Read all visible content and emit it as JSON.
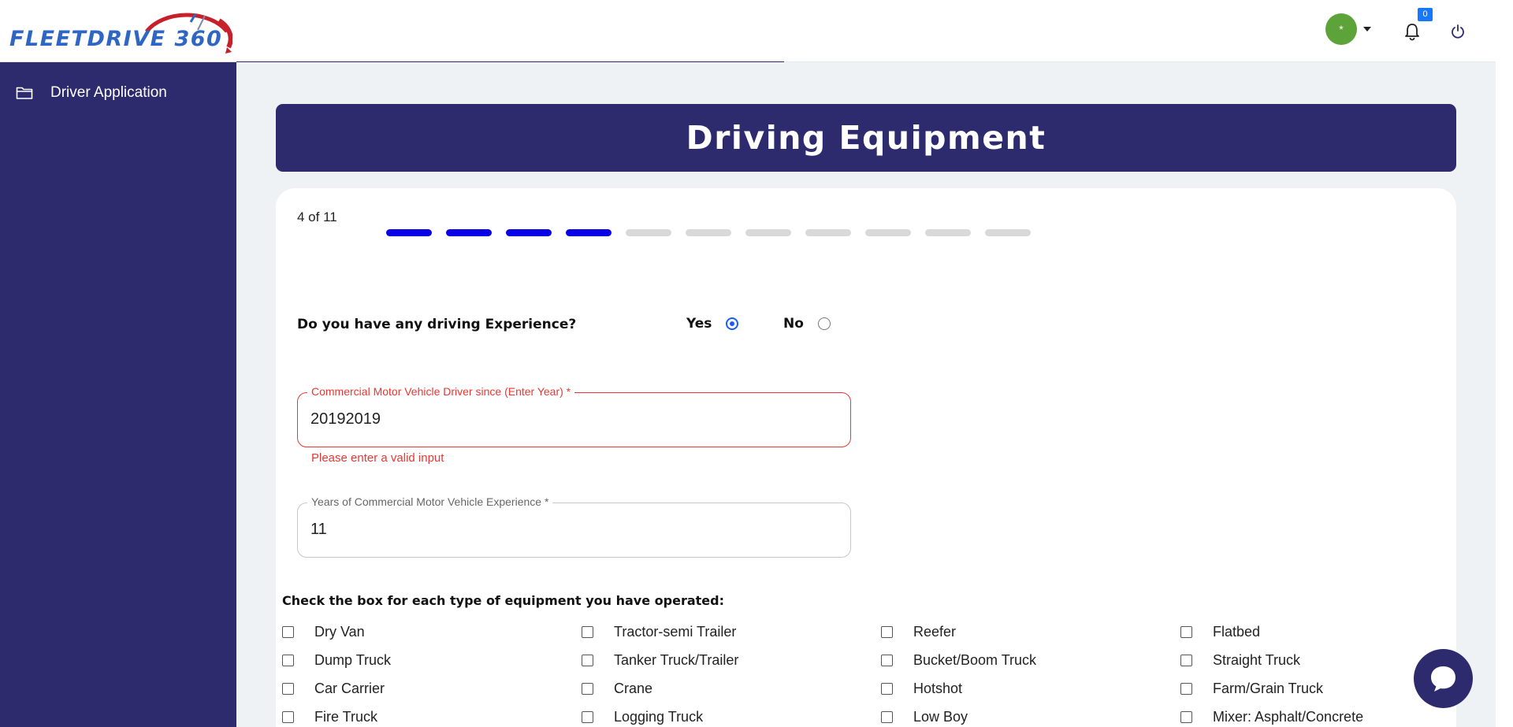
{
  "header": {
    "logo_text": "FLEETDRIVE 360",
    "avatar_initial": "*",
    "notification_count": "0"
  },
  "sidebar": {
    "items": [
      {
        "label": "Driver Application",
        "icon": "folder-icon"
      }
    ]
  },
  "banner": {
    "title": "Driving Equipment"
  },
  "progress": {
    "label": "4 of 11",
    "current": 4,
    "total": 11
  },
  "experience": {
    "question": "Do you have any driving Experience?",
    "yes_label": "Yes",
    "no_label": "No",
    "selected": "Yes"
  },
  "fields": {
    "driver_since": {
      "label": "Commercial Motor Vehicle Driver since (Enter Year)  *",
      "value": "20192019",
      "error": "Please enter a valid input"
    },
    "years_experience": {
      "label": "Years of Commercial Motor Vehicle Experience *",
      "value": "11"
    }
  },
  "equipment": {
    "title": "Check the box for each type of equipment you have operated:",
    "items": [
      "Dry Van",
      "Tractor-semi Trailer",
      "Reefer",
      "Flatbed",
      "Dump Truck",
      "Tanker Truck/Trailer",
      "Bucket/Boom Truck",
      "Straight Truck",
      "Car Carrier",
      "Crane",
      "Hotshot",
      "Farm/Grain Truck",
      "Fire Truck",
      "Logging Truck",
      "Low Boy",
      "Mixer: Asphalt/Concrete"
    ]
  },
  "colors": {
    "navy": "#2d2b6e",
    "progress_active": "#0a00e6",
    "error": "#e53935",
    "avatar": "#5ca33a",
    "radio_accent": "#1a5cf5"
  }
}
